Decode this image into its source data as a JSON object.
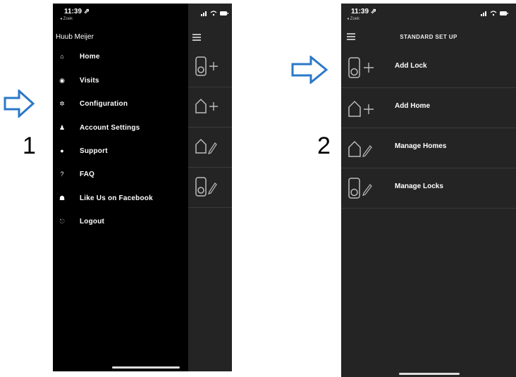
{
  "steps": [
    "1",
    "2"
  ],
  "colors": {
    "arrow": "#2a78c8",
    "screen_bg": "#242424",
    "drawer_bg": "#000000"
  },
  "screen1": {
    "status": {
      "time": "11:39 ⇗",
      "back": "◂ Zoek"
    },
    "user_name": "Huub Meijer",
    "menu": [
      {
        "icon": "home-icon",
        "glyph": "⌂",
        "label": "Home"
      },
      {
        "icon": "visits-icon",
        "glyph": "◉",
        "label": "Visits"
      },
      {
        "icon": "gear-icon",
        "glyph": "✲",
        "label": "Configuration"
      },
      {
        "icon": "user-icon",
        "glyph": "♟",
        "label": "Account Settings"
      },
      {
        "icon": "info-icon",
        "glyph": "●",
        "label": "Support"
      },
      {
        "icon": "question-icon",
        "glyph": "?",
        "label": "FAQ"
      },
      {
        "icon": "thumbs-up-icon",
        "glyph": "☗",
        "label": "Like Us on Facebook"
      },
      {
        "icon": "logout-icon",
        "glyph": "⎋",
        "label": "Logout"
      }
    ]
  },
  "screen2": {
    "status": {
      "time": "11:39 ⇗",
      "back": "◂ Zoek"
    },
    "title": "STANDARD SET UP",
    "rows": [
      {
        "icon": "add-lock-icon",
        "label": "Add Lock"
      },
      {
        "icon": "add-home-icon",
        "label": "Add Home"
      },
      {
        "icon": "edit-home-icon",
        "label": "Manage Homes"
      },
      {
        "icon": "edit-lock-icon",
        "label": "Manage Locks"
      }
    ]
  }
}
